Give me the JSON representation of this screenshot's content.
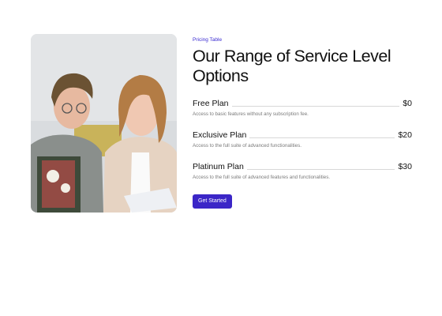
{
  "section": {
    "eyebrow": "Pricing Table",
    "title": "Our Range of Service Level Options"
  },
  "plans": [
    {
      "name": "Free Plan",
      "price": "$0",
      "description": "Access to basic features without any subscription fee."
    },
    {
      "name": "Exclusive Plan",
      "price": "$20",
      "description": "Access to the full suite of advanced functionalities."
    },
    {
      "name": "Platinum Plan",
      "price": "$30",
      "description": "Access to the full suite of advanced features and functionalities."
    }
  ],
  "cta": {
    "label": "Get Started"
  },
  "colors": {
    "accent": "#3b26c7",
    "eyebrow": "#3a2bd1",
    "muted_text": "#7a7a7a"
  }
}
